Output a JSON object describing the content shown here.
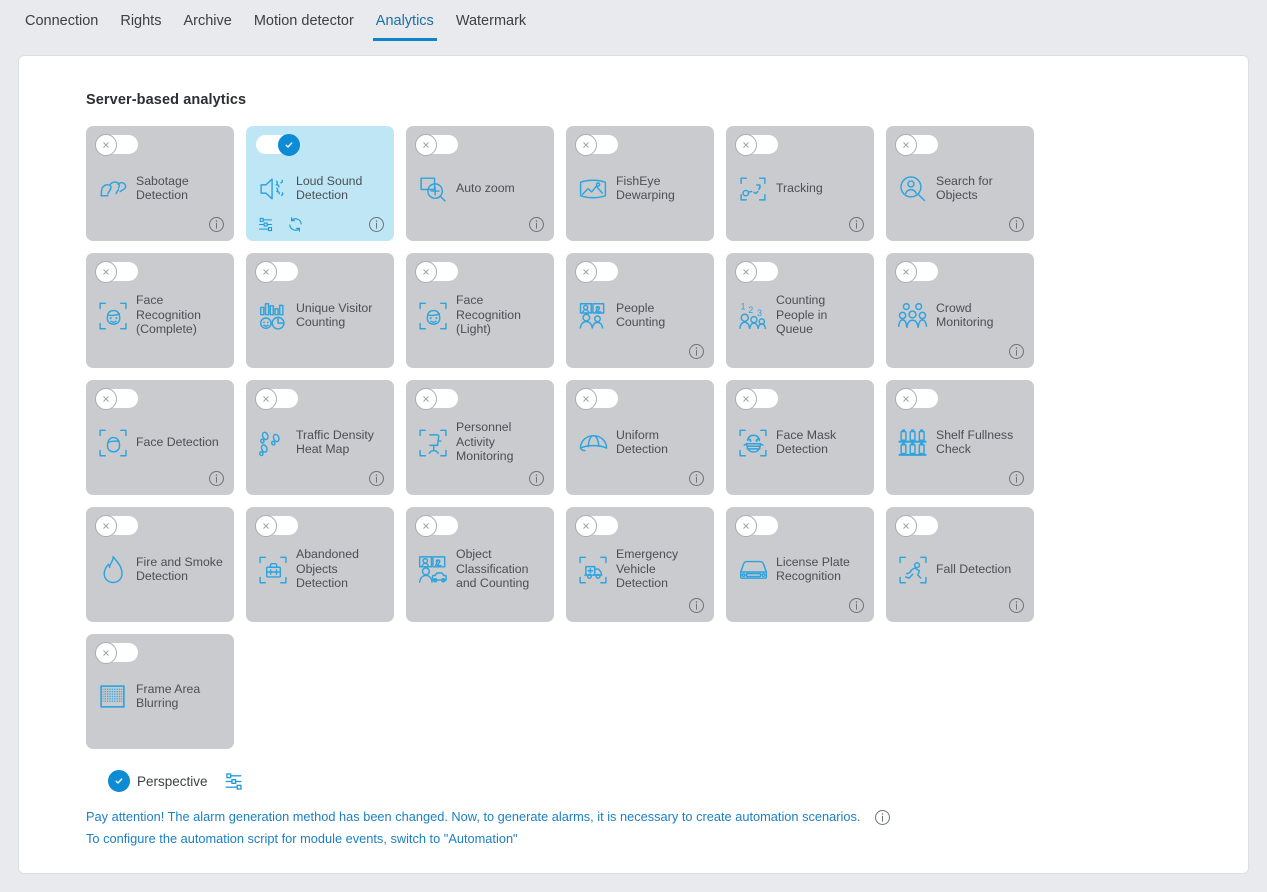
{
  "tabs": [
    {
      "label": "Connection",
      "active": false
    },
    {
      "label": "Rights",
      "active": false
    },
    {
      "label": "Archive",
      "active": false
    },
    {
      "label": "Motion detector",
      "active": false
    },
    {
      "label": "Analytics",
      "active": true
    },
    {
      "label": "Watermark",
      "active": false
    }
  ],
  "section": {
    "title": "Server-based analytics"
  },
  "colors": {
    "accent": "#0b86c8",
    "icon_blue": "#2ea3dd",
    "card_off_bg": "#c9cbcf",
    "card_on_bg": "#bfe6f5",
    "toggle_on": "#0d8bd4",
    "note_text": "#1b7fc4"
  },
  "cards": [
    {
      "label": "Sabotage Detection",
      "icon": "sabotage-icon",
      "enabled": false,
      "has_info": true,
      "has_settings": false,
      "has_sync": false
    },
    {
      "label": "Loud Sound Detection",
      "icon": "loud-sound-icon",
      "enabled": true,
      "has_info": true,
      "has_settings": true,
      "has_sync": true
    },
    {
      "label": "Auto zoom",
      "icon": "auto-zoom-icon",
      "enabled": false,
      "has_info": true,
      "has_settings": false,
      "has_sync": false
    },
    {
      "label": "FishEye Dewarping",
      "icon": "fisheye-dewarping-icon",
      "enabled": false,
      "has_info": false,
      "has_settings": false,
      "has_sync": false
    },
    {
      "label": "Tracking",
      "icon": "tracking-icon",
      "enabled": false,
      "has_info": true,
      "has_settings": false,
      "has_sync": false
    },
    {
      "label": "Search for Objects",
      "icon": "search-objects-icon",
      "enabled": false,
      "has_info": true,
      "has_settings": false,
      "has_sync": false
    },
    {
      "label": "Face Recognition (Complete)",
      "icon": "face-recognition-complete-icon",
      "enabled": false,
      "has_info": false,
      "has_settings": false,
      "has_sync": false
    },
    {
      "label": "Unique Visitor Counting",
      "icon": "unique-visitor-counting-icon",
      "enabled": false,
      "has_info": false,
      "has_settings": false,
      "has_sync": false
    },
    {
      "label": "Face Recognition (Light)",
      "icon": "face-recognition-light-icon",
      "enabled": false,
      "has_info": false,
      "has_settings": false,
      "has_sync": false
    },
    {
      "label": "People Counting",
      "icon": "people-counting-icon",
      "enabled": false,
      "has_info": true,
      "has_settings": false,
      "has_sync": false
    },
    {
      "label": "Counting People in Queue",
      "icon": "counting-people-queue-icon",
      "enabled": false,
      "has_info": false,
      "has_settings": false,
      "has_sync": false
    },
    {
      "label": "Crowd Monitoring",
      "icon": "crowd-monitoring-icon",
      "enabled": false,
      "has_info": true,
      "has_settings": false,
      "has_sync": false
    },
    {
      "label": "Face Detection",
      "icon": "face-detection-icon",
      "enabled": false,
      "has_info": true,
      "has_settings": false,
      "has_sync": false
    },
    {
      "label": "Traffic Density Heat Map",
      "icon": "traffic-density-heatmap-icon",
      "enabled": false,
      "has_info": true,
      "has_settings": false,
      "has_sync": false
    },
    {
      "label": "Personnel Activity Monitoring",
      "icon": "personnel-activity-icon",
      "enabled": false,
      "has_info": true,
      "has_settings": false,
      "has_sync": false
    },
    {
      "label": "Uniform Detection",
      "icon": "uniform-detection-icon",
      "enabled": false,
      "has_info": true,
      "has_settings": false,
      "has_sync": false
    },
    {
      "label": "Face Mask Detection",
      "icon": "face-mask-detection-icon",
      "enabled": false,
      "has_info": false,
      "has_settings": false,
      "has_sync": false
    },
    {
      "label": "Shelf Fullness Check",
      "icon": "shelf-fullness-icon",
      "enabled": false,
      "has_info": true,
      "has_settings": false,
      "has_sync": false
    },
    {
      "label": "Fire and Smoke Detection",
      "icon": "fire-smoke-icon",
      "enabled": false,
      "has_info": false,
      "has_settings": false,
      "has_sync": false
    },
    {
      "label": "Abandoned Objects Detection",
      "icon": "abandoned-objects-icon",
      "enabled": false,
      "has_info": false,
      "has_settings": false,
      "has_sync": false
    },
    {
      "label": "Object Classification and Counting",
      "icon": "object-classification-icon",
      "enabled": false,
      "has_info": false,
      "has_settings": false,
      "has_sync": false
    },
    {
      "label": "Emergency Vehicle Detection",
      "icon": "emergency-vehicle-icon",
      "enabled": false,
      "has_info": true,
      "has_settings": false,
      "has_sync": false
    },
    {
      "label": "License Plate Recognition",
      "icon": "license-plate-icon",
      "enabled": false,
      "has_info": true,
      "has_settings": false,
      "has_sync": false
    },
    {
      "label": "Fall Detection",
      "icon": "fall-detection-icon",
      "enabled": false,
      "has_info": true,
      "has_settings": false,
      "has_sync": false
    },
    {
      "label": "Frame Area Blurring",
      "icon": "frame-area-blurring-icon",
      "enabled": false,
      "has_info": false,
      "has_settings": false,
      "has_sync": false
    }
  ],
  "perspective": {
    "label": "Perspective",
    "enabled": true,
    "settings_icon": "sliders-icon"
  },
  "notes": {
    "line1": "Pay attention! The alarm generation method has been changed. Now, to generate alarms, it is necessary to create automation scenarios.",
    "line2": "To configure the automation script for module events, switch to \"Automation\""
  }
}
